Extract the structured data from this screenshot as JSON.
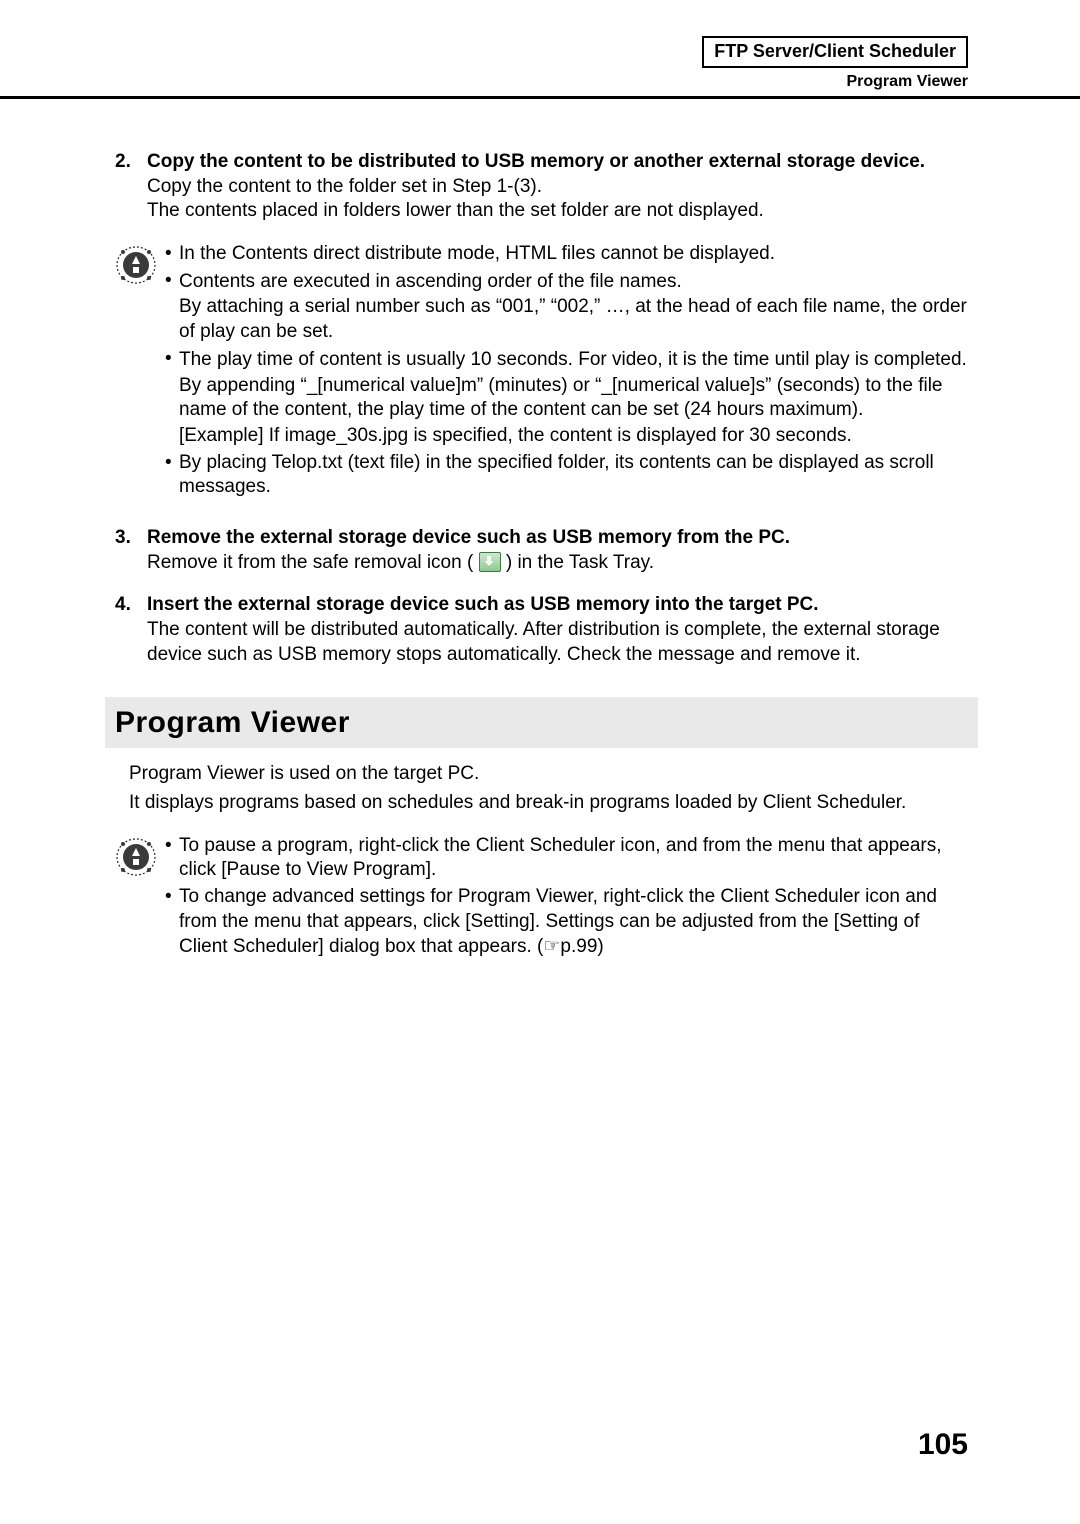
{
  "header": {
    "title": "FTP Server/Client Scheduler",
    "subtitle": "Program Viewer"
  },
  "steps": {
    "s2": {
      "num": "2.",
      "title": "Copy the content to be distributed to USB memory or another external storage device.",
      "line1": "Copy the content to the folder set in Step 1-(3).",
      "line2": "The contents placed in folders lower than the set folder are not displayed."
    },
    "s3": {
      "num": "3.",
      "title": "Remove the external storage device such as USB memory from the PC.",
      "line1a": "Remove it from the safe removal icon (",
      "line1b": ") in the Task Tray."
    },
    "s4": {
      "num": "4.",
      "title": "Insert the external storage device such as USB memory into the target PC.",
      "line1": "The content will be distributed automatically. After distribution is complete, the external storage device such as USB memory stops automatically. Check the message and remove it."
    }
  },
  "tips1": {
    "b1": "In the Contents direct distribute mode, HTML files cannot be displayed.",
    "b2a": "Contents are executed in ascending order of the file names.",
    "b2b": "By attaching a serial number such as “001,” “002,” …, at the head of each file name, the order of play can be set.",
    "b3a": "The play time of content is usually 10 seconds. For video, it is the time until play is completed.",
    "b3b": "By appending “_[numerical value]m” (minutes) or “_[numerical value]s” (seconds) to the file name of the content, the play time of the content can be set (24 hours maximum).",
    "b3c": "[Example] If image_30s.jpg is specified, the content is displayed for 30 seconds.",
    "b4": "By placing Telop.txt (text file) in the specified folder, its contents can be displayed as scroll messages."
  },
  "section": {
    "title": "Program Viewer",
    "intro1": "Program Viewer is used on the target PC.",
    "intro2": "It displays programs based on schedules and break-in programs loaded by Client Scheduler."
  },
  "tips2": {
    "b1": "To pause a program, right-click the Client Scheduler icon, and from the menu that appears, click [Pause to View Program].",
    "b2": "To change advanced settings for Program Viewer, right-click the Client Scheduler icon and from the menu that appears, click [Setting]. Settings can be adjusted from the [Setting of Client Scheduler] dialog box that appears. (☞p.99)"
  },
  "pagenum": "105"
}
